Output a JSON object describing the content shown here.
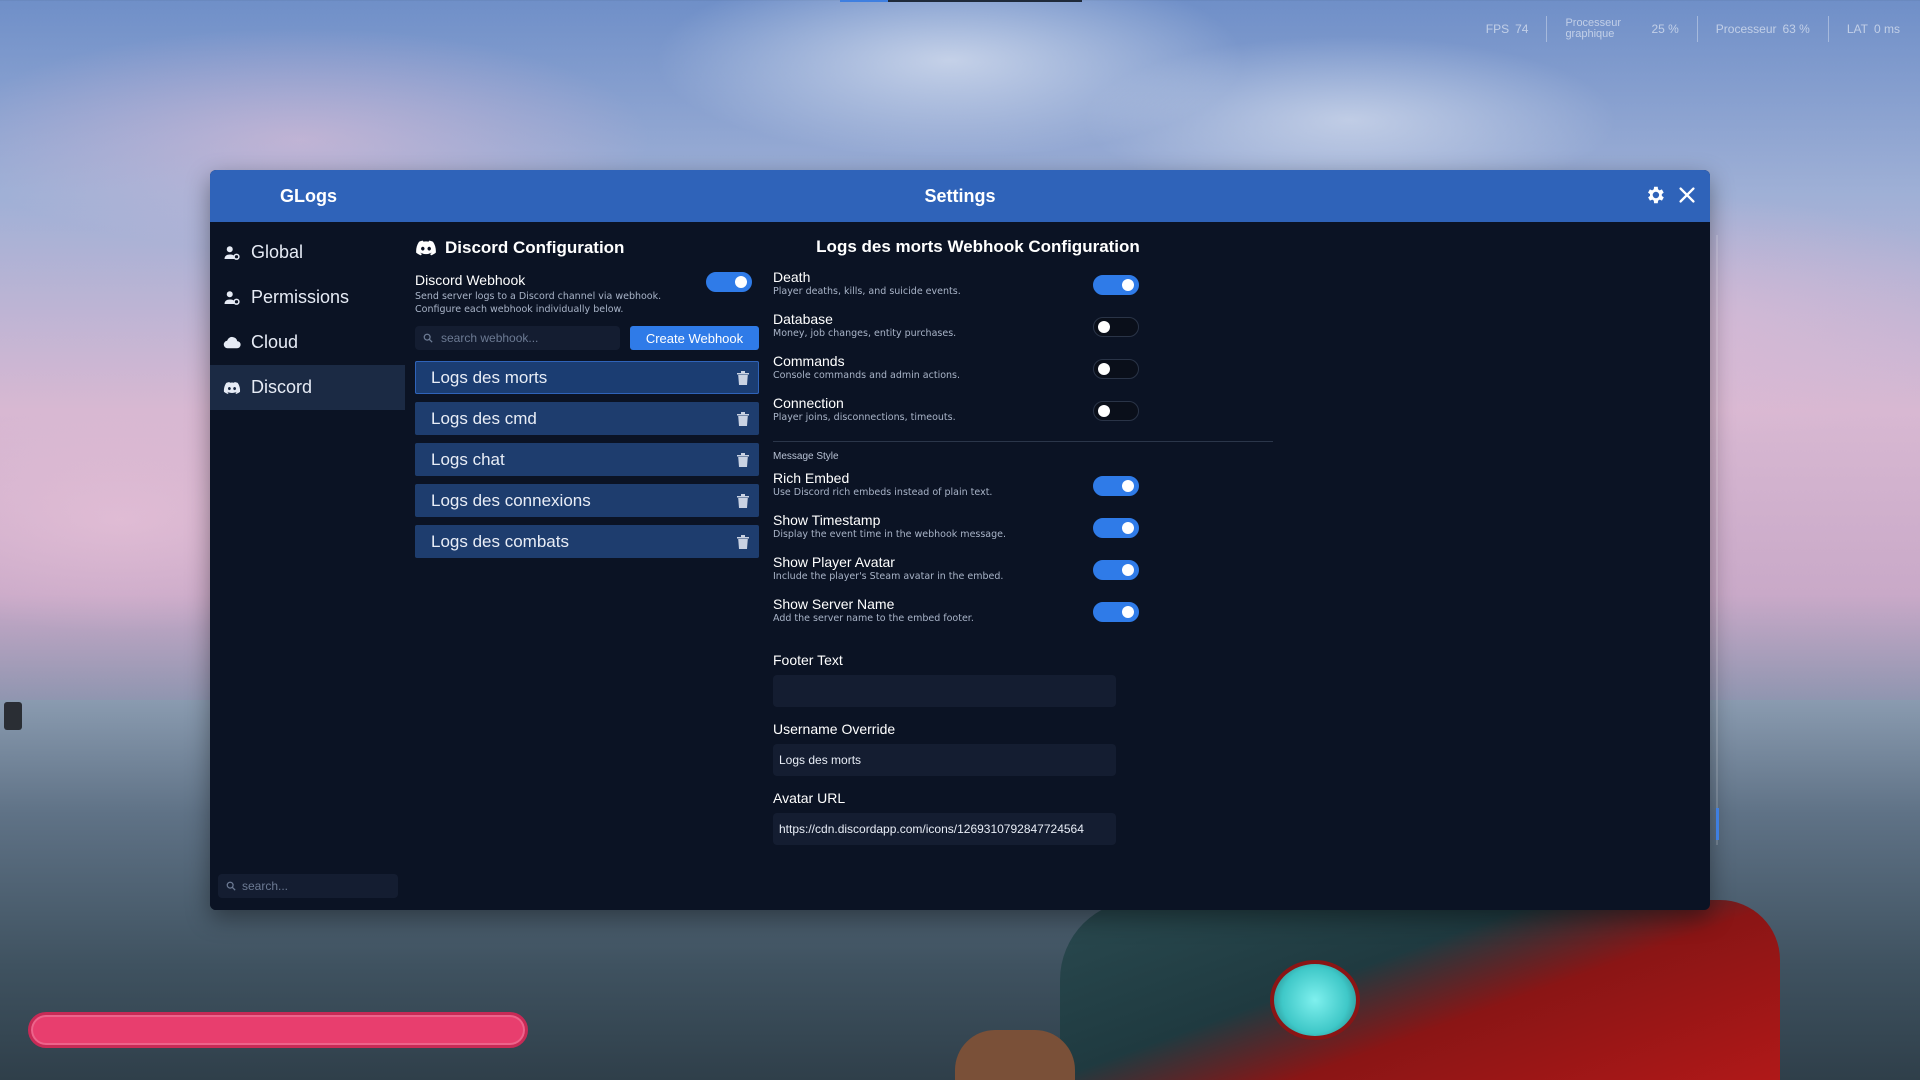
{
  "hud": {
    "fps_label": "FPS",
    "fps_value": "74",
    "gpu_label": "Processeur graphique",
    "gpu_value": "25 %",
    "cpu_label": "Processeur",
    "cpu_value": "63 %",
    "lat_label": "LAT",
    "lat_value": "0 ms"
  },
  "window": {
    "app_name": "GLogs",
    "title": "Settings"
  },
  "sidebar": {
    "items": [
      {
        "label": "Global",
        "icon": "user-settings-icon"
      },
      {
        "label": "Permissions",
        "icon": "user-settings-icon"
      },
      {
        "label": "Cloud",
        "icon": "cloud-icon"
      },
      {
        "label": "Discord",
        "icon": "discord-icon"
      }
    ],
    "search_placeholder": "search..."
  },
  "discord_config": {
    "title": "Discord Configuration",
    "webhook_label": "Discord Webhook",
    "webhook_desc_1": "Send server logs to a Discord channel via webhook.",
    "webhook_desc_2": "Configure each webhook individually below.",
    "webhook_enabled": true,
    "search_placeholder": "search webhook...",
    "create_button": "Create Webhook",
    "webhooks": [
      "Logs des morts",
      "Logs des cmd",
      "Logs chat",
      "Logs des connexions",
      "Logs des combats"
    ]
  },
  "webhook_config": {
    "title": "Logs des morts Webhook Configuration",
    "events": [
      {
        "label": "Death",
        "desc": "Player deaths, kills, and suicide events.",
        "on": true
      },
      {
        "label": "Database",
        "desc": "Money, job changes, entity purchases.",
        "on": false
      },
      {
        "label": "Commands",
        "desc": "Console commands and admin actions.",
        "on": false
      },
      {
        "label": "Connection",
        "desc": "Player joins, disconnections, timeouts.",
        "on": false
      }
    ],
    "style_heading": "Message Style",
    "style": [
      {
        "label": "Rich Embed",
        "desc": "Use Discord rich embeds instead of plain text.",
        "on": true
      },
      {
        "label": "Show Timestamp",
        "desc": "Display the event time in the webhook message.",
        "on": true
      },
      {
        "label": "Show Player Avatar",
        "desc": "Include the player's Steam avatar in the embed.",
        "on": true
      },
      {
        "label": "Show Server Name",
        "desc": "Add the server name to the embed footer.",
        "on": true
      }
    ],
    "footer_label": "Footer Text",
    "footer_value": "",
    "username_label": "Username Override",
    "username_value": "Logs des morts",
    "avatar_label": "Avatar URL",
    "avatar_value": "https://cdn.discordapp.com/icons/1269310792847724564"
  },
  "colors": {
    "titlebar": "#2f63b9",
    "accent": "#2f7be8",
    "panel": "#0b1324",
    "list_item": "#1e3d6e",
    "health": "#e83e6e"
  }
}
